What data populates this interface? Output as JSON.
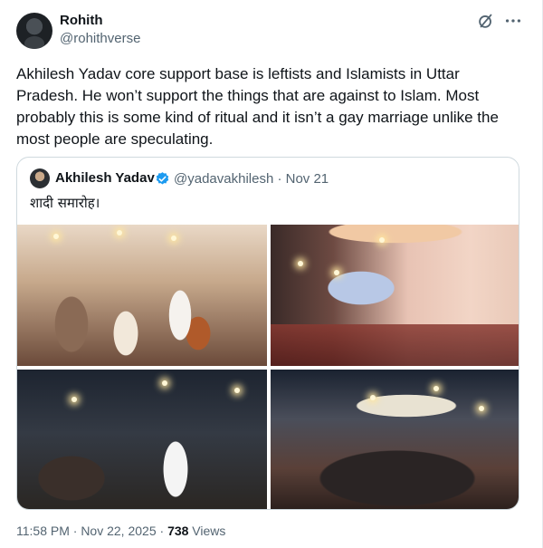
{
  "author": {
    "name": "Rohith",
    "handle": "@rohithverse"
  },
  "tweet_text": "Akhilesh Yadav core support base is leftists and Islamists in Uttar Pradesh. He won’t support the things that are against to Islam. Most probably this is some kind of ritual and it isn’t a gay marriage unlike the most people are speculating.",
  "quoted": {
    "name": "Akhilesh Yadav",
    "handle": "@yadavakhilesh · Nov 21",
    "text": "शादी समारोह।",
    "verified_color": "#1d9bf0"
  },
  "photos": [
    "wedding-stage-photo",
    "banquet-hall-photo",
    "crowd-greeting-photo",
    "night-crowd-photo"
  ],
  "meta": {
    "timestamp": "11:58 PM · Nov 22, 2025 · ",
    "views_count": "738",
    "views_label": " Views"
  },
  "colors": {
    "text": "#0f1419",
    "secondary": "#536471",
    "border": "#cfd9de",
    "accent": "#1d9bf0"
  }
}
